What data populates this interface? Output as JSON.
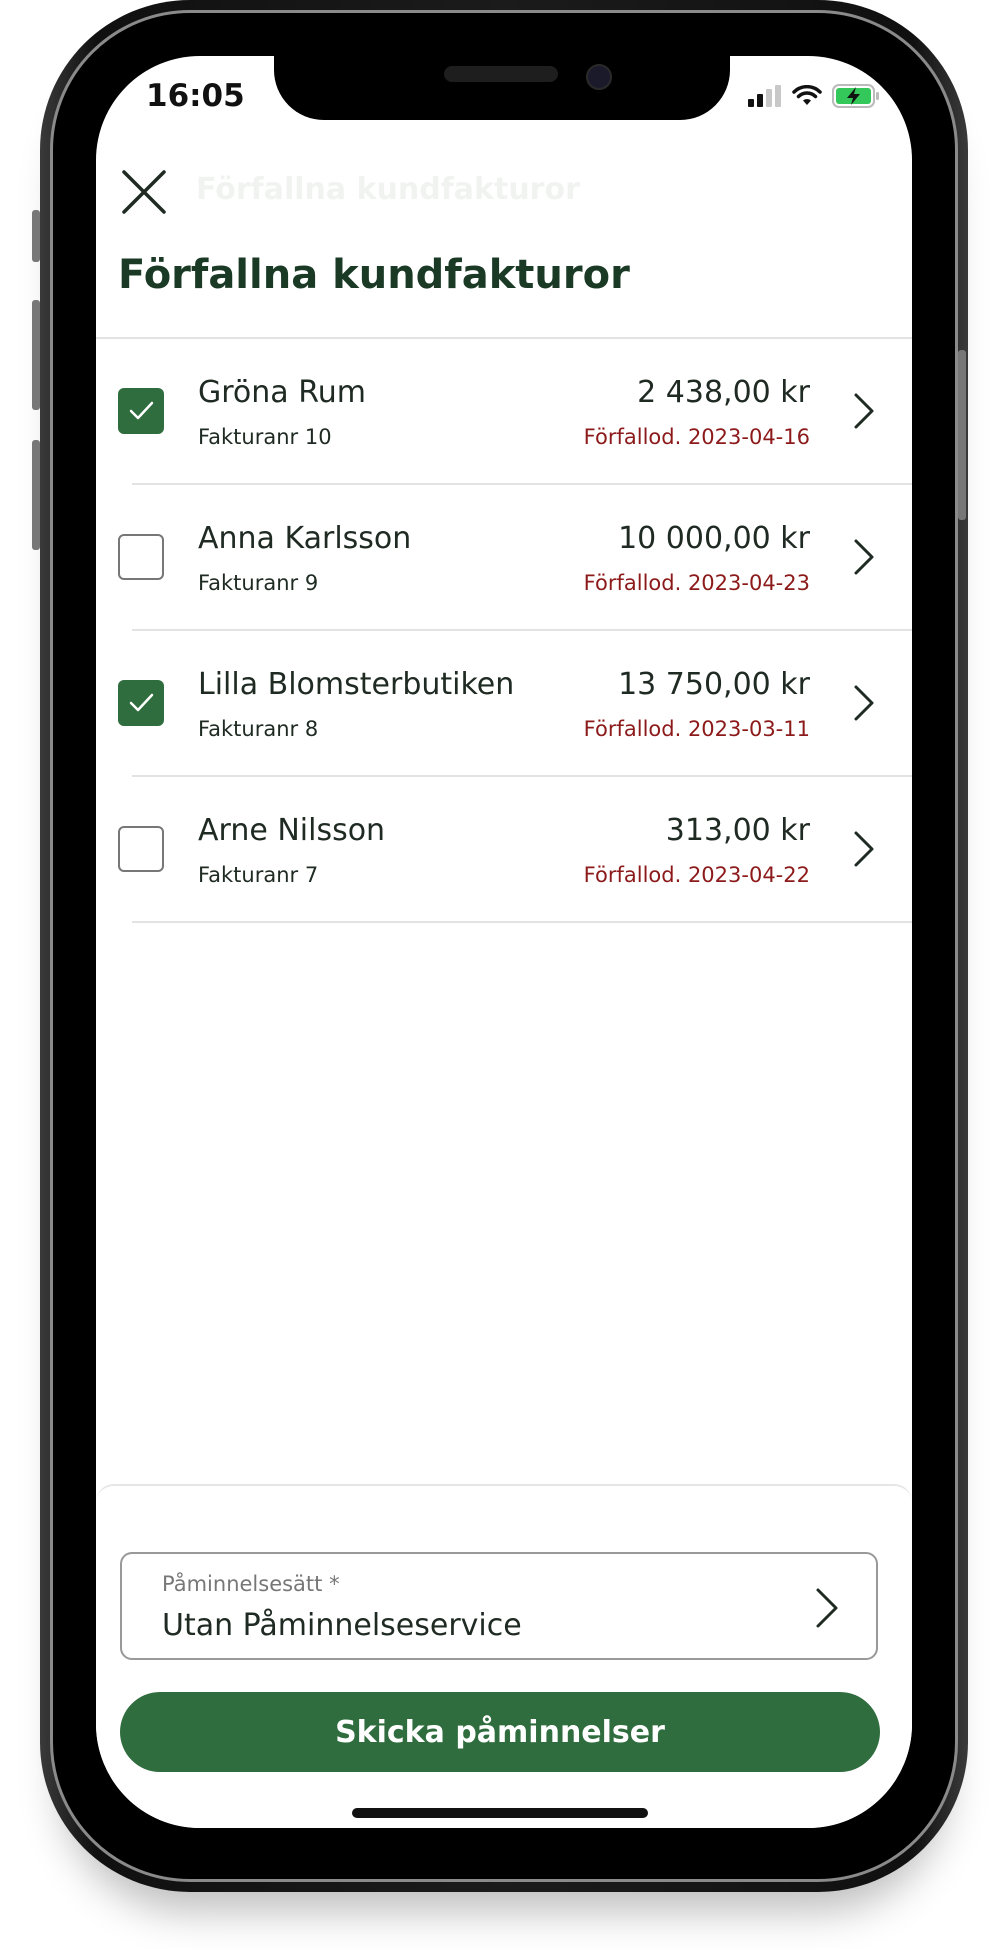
{
  "status_bar": {
    "time": "16:05",
    "signal_icon": "cellular-signal-icon",
    "wifi_icon": "wifi-icon",
    "battery_icon": "battery-charging-icon"
  },
  "header": {
    "close_icon": "close-icon",
    "collapsed_title": "Förfallna kundfakturor",
    "title": "Förfallna kundfakturor"
  },
  "invoices": [
    {
      "customer": "Gröna Rum",
      "invoice_number": "Fakturanr 10",
      "amount": "2 438,00 kr",
      "due": "Förfallod. 2023-04-16",
      "selected": true
    },
    {
      "customer": "Anna Karlsson",
      "invoice_number": "Fakturanr 9",
      "amount": "10 000,00 kr",
      "due": "Förfallod. 2023-04-23",
      "selected": false
    },
    {
      "customer": "Lilla Blomsterbutiken",
      "invoice_number": "Fakturanr 8",
      "amount": "13 750,00 kr",
      "due": "Förfallod. 2023-03-11",
      "selected": true
    },
    {
      "customer": "Arne Nilsson",
      "invoice_number": "Fakturanr 7",
      "amount": "313,00 kr",
      "due": "Förfallod. 2023-04-22",
      "selected": false
    }
  ],
  "reminder_method": {
    "label": "Påminnelsesätt *",
    "value": "Utan Påminnelseservice"
  },
  "actions": {
    "send_label": "Skicka påminnelser"
  },
  "colors": {
    "brand_green": "#2f6d3e",
    "title_green": "#1a3a26",
    "overdue_red": "#8c1a1a"
  }
}
